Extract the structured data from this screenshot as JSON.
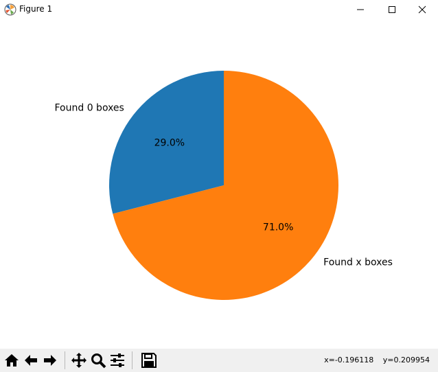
{
  "window": {
    "title": "Figure 1",
    "icon": "matplotlib-logo-icon",
    "controls": [
      "minimize-icon",
      "maximize-icon",
      "close-icon"
    ]
  },
  "chart_data": {
    "type": "pie",
    "labels": [
      "Found 0 boxes",
      "Found x boxes"
    ],
    "values": [
      29.0,
      71.0
    ],
    "autopct_labels": [
      "29.0%",
      "71.0%"
    ],
    "colors": [
      "#1f77b4",
      "#ff7f0e"
    ],
    "startangle_deg": 90,
    "direction": "counterclockwise",
    "title": "",
    "legend": "none"
  },
  "toolbar": {
    "buttons": [
      "home-icon",
      "back-icon",
      "forward-icon",
      "pan-icon",
      "zoom-icon",
      "configure-subplots-icon",
      "save-icon"
    ],
    "coords": {
      "x": "x=-0.196118",
      "y": "y=0.209954"
    }
  }
}
